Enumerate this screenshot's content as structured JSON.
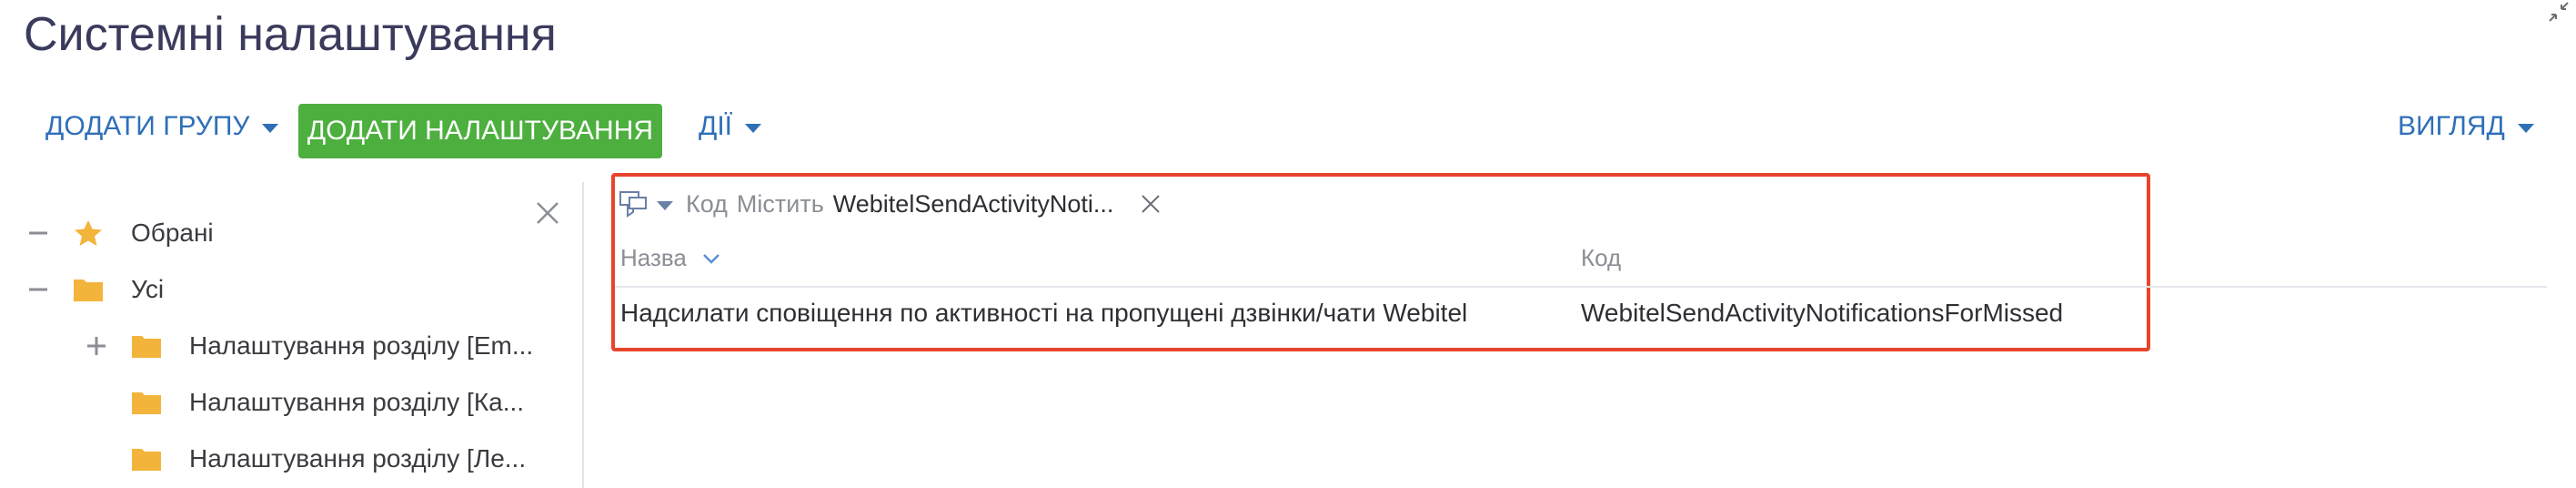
{
  "header": {
    "title": "Системні налаштування"
  },
  "toolbar": {
    "add_group_label": "ДОДАТИ ГРУПУ",
    "add_setting_label": "ДОДАТИ НАЛАШТУВАННЯ",
    "actions_label": "ДІЇ",
    "view_label": "ВИГЛЯД"
  },
  "sidebar": {
    "items": [
      {
        "label": "Обрані",
        "icon": "star-icon",
        "toggle": "collapse"
      },
      {
        "label": "Усі",
        "icon": "folder-icon",
        "toggle": "collapse"
      },
      {
        "label": "Налаштування розділу [Em...",
        "icon": "folder-icon",
        "toggle": "expand"
      },
      {
        "label": "Налаштування розділу [Ка...",
        "icon": "folder-icon",
        "toggle": "none"
      },
      {
        "label": "Налаштування розділу [Ле...",
        "icon": "folder-icon",
        "toggle": "none"
      }
    ]
  },
  "filter": {
    "column": "Код",
    "operator": "Містить",
    "value": "WebitelSendActivityNoti..."
  },
  "grid": {
    "columns": [
      "Назва",
      "Код"
    ],
    "rows": [
      [
        "Надсилати сповіщення по активності на пропущені дзвінки/чати Webitel",
        "WebitelSendActivityNotificationsForMissed"
      ]
    ]
  },
  "colors": {
    "accent": "#2f6fb8",
    "primary_button": "#4caf3e",
    "highlight_border": "#e8442b",
    "folder": "#f3b43c",
    "star": "#f3b43c"
  }
}
